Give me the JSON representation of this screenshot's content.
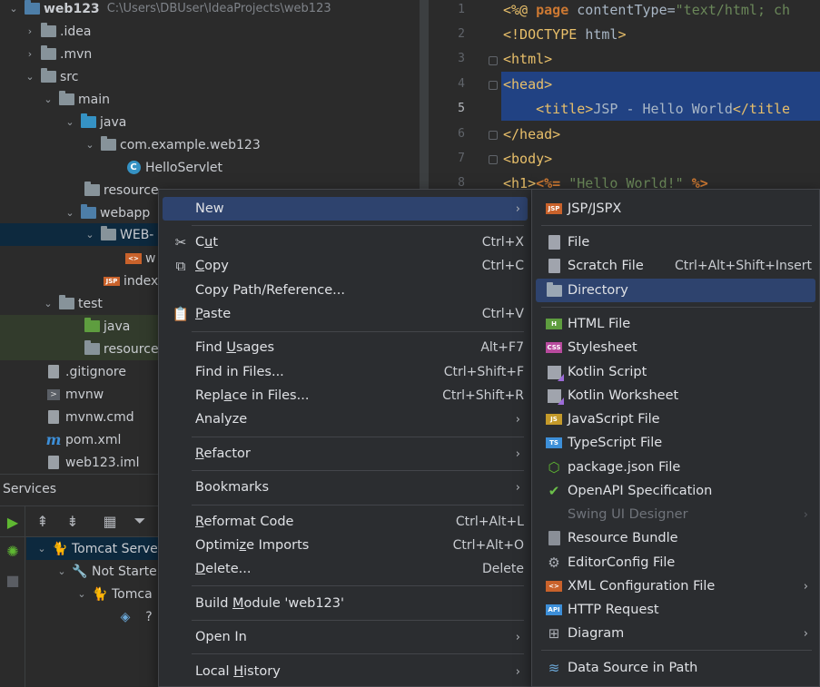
{
  "project": {
    "rows": [
      {
        "label": "web123",
        "path": "C:\\Users\\DBUser\\IdeaProjects\\web123"
      },
      {
        "label": ".idea"
      },
      {
        "label": ".mvn"
      },
      {
        "label": "src"
      },
      {
        "label": "main"
      },
      {
        "label": "java"
      },
      {
        "label": "com.example.web123"
      },
      {
        "label": "HelloServlet"
      },
      {
        "label": "resource"
      },
      {
        "label": "webapp"
      },
      {
        "label": "WEB-"
      },
      {
        "label": "w"
      },
      {
        "label": "index"
      },
      {
        "label": "test"
      },
      {
        "label": "java"
      },
      {
        "label": "resource"
      },
      {
        "label": ".gitignore"
      },
      {
        "label": "mvnw"
      },
      {
        "label": "mvnw.cmd"
      },
      {
        "label": "pom.xml"
      },
      {
        "label": "web123.iml"
      }
    ]
  },
  "editor": {
    "line_numbers": [
      "1",
      "2",
      "3",
      "4",
      "5",
      "6",
      "7",
      "8"
    ],
    "lines": [
      {
        "a": "<%@ ",
        "b": "page",
        "c": " contentType=",
        "d": "\"text/html; ch"
      },
      {
        "a": "<!DOCTYPE ",
        "b": "html",
        "c": ">"
      },
      {
        "a": "<html>"
      },
      {
        "a": "<head>"
      },
      {
        "a": "    <title>",
        "b": "JSP - Hello World",
        "c": "</title"
      },
      {
        "a": "</head>"
      },
      {
        "a": "<body>"
      },
      {
        "a": "<h1>",
        "b": "<%= ",
        "c": "\"Hello World!\"",
        "d": " %>"
      }
    ]
  },
  "services": {
    "title": "Services",
    "tree": [
      {
        "label": "Tomcat Serve"
      },
      {
        "label": "Not Starte"
      },
      {
        "label": "Tomca"
      }
    ]
  },
  "context_menu": {
    "items": [
      {
        "label": "New",
        "arrow": "›"
      },
      {
        "label_pre": "C",
        "label_u": "u",
        "label_post": "t",
        "shortcut": "Ctrl+X"
      },
      {
        "label_u": "C",
        "label_post": "opy",
        "shortcut": "Ctrl+C"
      },
      {
        "label": "Copy Path/Reference..."
      },
      {
        "label_u": "P",
        "label_post": "aste",
        "shortcut": "Ctrl+V"
      },
      {
        "label_pre": "Find ",
        "label_u": "U",
        "label_post": "sages",
        "shortcut": "Alt+F7"
      },
      {
        "label": "Find in Files...",
        "shortcut": "Ctrl+Shift+F"
      },
      {
        "label_pre": "Repl",
        "label_u": "a",
        "label_post": "ce in Files...",
        "shortcut": "Ctrl+Shift+R"
      },
      {
        "label": "Analyze",
        "arrow": "›"
      },
      {
        "label_u": "R",
        "label_post": "efactor",
        "arrow": "›"
      },
      {
        "label": "Bookmarks",
        "arrow": "›"
      },
      {
        "label_u": "R",
        "label_post": "eformat Code",
        "shortcut": "Ctrl+Alt+L"
      },
      {
        "label_pre": "Optimi",
        "label_u": "z",
        "label_post": "e Imports",
        "shortcut": "Ctrl+Alt+O"
      },
      {
        "label_u": "D",
        "label_post": "elete...",
        "shortcut": "Delete"
      },
      {
        "label_pre": "Build ",
        "label_u": "M",
        "label_post": "odule 'web123'"
      },
      {
        "label": "Open In",
        "arrow": "›"
      },
      {
        "label_pre": "Local ",
        "label_u": "H",
        "label_post": "istory",
        "arrow": "›"
      }
    ]
  },
  "new_submenu": {
    "items": [
      {
        "label": "JSP/JSPX",
        "icon": "jsp-file-icon",
        "badge": "JSP"
      },
      {
        "label": "File",
        "icon": "file-icon"
      },
      {
        "label": "Scratch File",
        "icon": "scratch-file-icon",
        "shortcut": "Ctrl+Alt+Shift+Insert"
      },
      {
        "label": "Directory",
        "icon": "folder-icon"
      },
      {
        "label": "HTML File",
        "icon": "html-file-icon",
        "badge": "H"
      },
      {
        "label": "Stylesheet",
        "icon": "css-file-icon",
        "badge": "CSS"
      },
      {
        "label": "Kotlin Script",
        "icon": "kotlin-script-icon"
      },
      {
        "label": "Kotlin Worksheet",
        "icon": "kotlin-worksheet-icon"
      },
      {
        "label": "JavaScript File",
        "icon": "javascript-file-icon",
        "badge": "JS"
      },
      {
        "label": "TypeScript File",
        "icon": "typescript-file-icon",
        "badge": "TS"
      },
      {
        "label": "package.json File",
        "icon": "nodejs-icon",
        "badge": "⬡"
      },
      {
        "label": "OpenAPI Specification",
        "icon": "openapi-icon",
        "badge": "✔"
      },
      {
        "label": "Swing UI Designer",
        "icon": "",
        "arrow": "›"
      },
      {
        "label": "Resource Bundle",
        "icon": "resource-bundle-icon"
      },
      {
        "label": "EditorConfig File",
        "icon": "gear-icon",
        "badge": "⚙"
      },
      {
        "label": "XML Configuration File",
        "icon": "xml-file-icon",
        "badge": "<>",
        "arrow": "›"
      },
      {
        "label": "HTTP Request",
        "icon": "http-request-icon",
        "badge": "API"
      },
      {
        "label": "Diagram",
        "icon": "diagram-icon",
        "arrow": "›"
      },
      {
        "label": "Data Source in Path",
        "icon": "database-icon",
        "badge": "≋"
      }
    ]
  },
  "colors": {
    "highlight": "#2e436e",
    "menu_bg": "#2b2d30",
    "selected_row": "#0d293e",
    "editor_selection": "#214283"
  }
}
